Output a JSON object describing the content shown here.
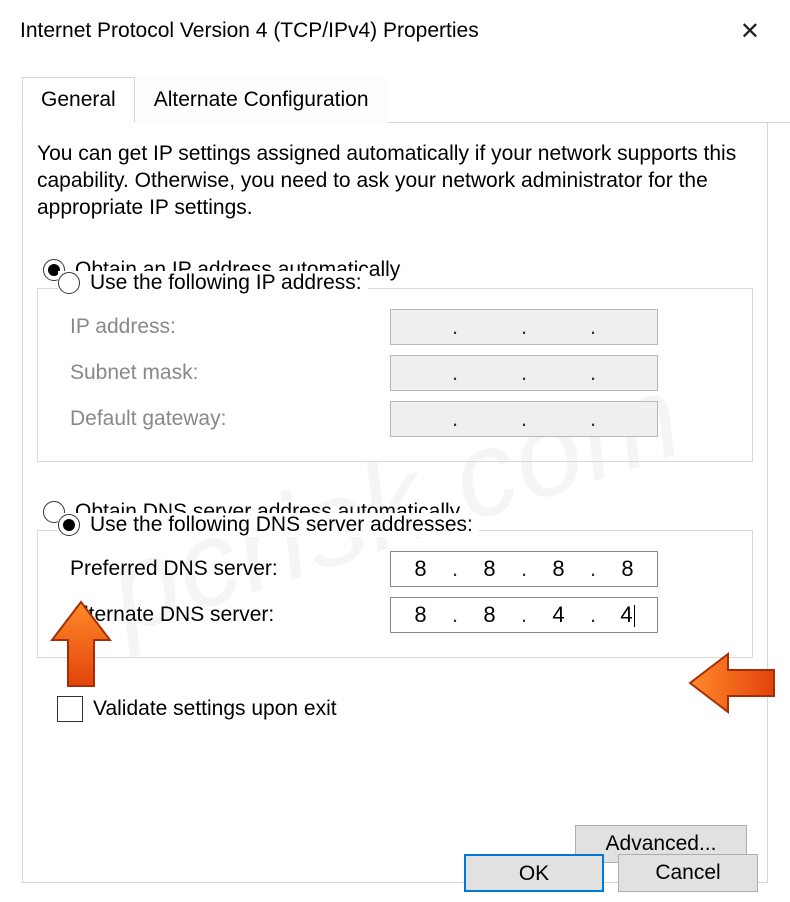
{
  "window": {
    "title": "Internet Protocol Version 4 (TCP/IPv4) Properties"
  },
  "tabs": {
    "general": "General",
    "alternate": "Alternate Configuration"
  },
  "intro": "You can get IP settings assigned automatically if your network supports this capability. Otherwise, you need to ask your network administrator for the appropriate IP settings.",
  "ip": {
    "auto_label": "Obtain an IP address automatically",
    "manual_label": "Use the following IP address:",
    "ip_label": "IP address:",
    "subnet_label": "Subnet mask:",
    "gateway_label": "Default gateway:",
    "ip_value": [
      "",
      "",
      "",
      ""
    ],
    "subnet_value": [
      "",
      "",
      "",
      ""
    ],
    "gateway_value": [
      "",
      "",
      "",
      ""
    ]
  },
  "dns": {
    "auto_label": "Obtain DNS server address automatically",
    "manual_label": "Use the following DNS server addresses:",
    "pref_label": "Preferred DNS server:",
    "alt_label": "Alternate DNS server:",
    "pref_value": [
      "8",
      "8",
      "8",
      "8"
    ],
    "alt_value": [
      "8",
      "8",
      "4",
      "4"
    ]
  },
  "validate_label": "Validate settings upon exit",
  "advanced_label": "Advanced...",
  "buttons": {
    "ok": "OK",
    "cancel": "Cancel"
  },
  "watermark": "pcrisk.com"
}
